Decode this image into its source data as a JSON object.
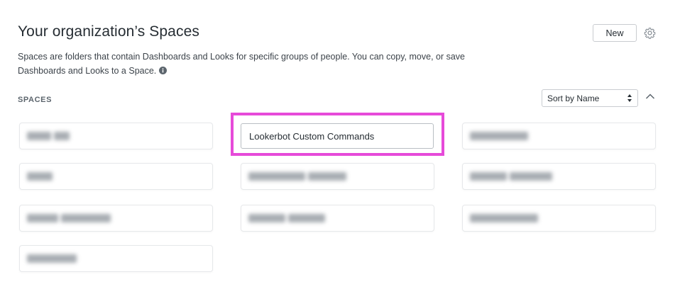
{
  "header": {
    "title": "Your organization’s Spaces",
    "new_button_label": "New",
    "settings_icon": "gear-icon"
  },
  "description": {
    "text": "Spaces are folders that contain Dashboards and Looks for specific groups of people. You can copy, move, or save Dashboards and Looks to a Space.",
    "info_icon": "info-icon"
  },
  "spaces_section": {
    "label": "SPACES",
    "sort_select": {
      "selected": "Sort by Name"
    },
    "collapse_icon": "chevron-up-icon",
    "highlighted_space": "Lookerbot Custom Commands",
    "highlight_color": "#e64ad9"
  }
}
